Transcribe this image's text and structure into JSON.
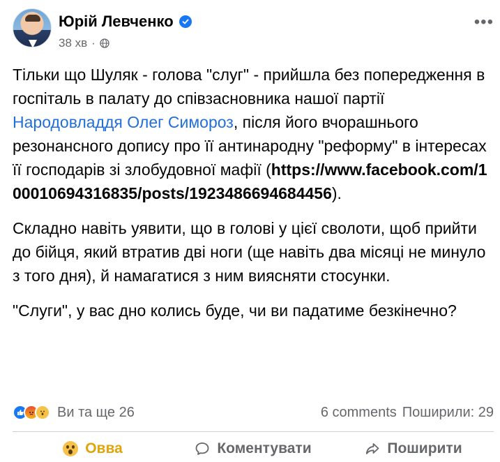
{
  "post": {
    "author": "Юрій Левченко",
    "time": "38 хв",
    "privacy_icon": "globe-icon",
    "more_label": "•••",
    "paragraphs": {
      "p1_a": "Тільки що Шуляк - голова \"слуг\" - прийшла без попередження в госпіталь в палату до співзасновника нашої партії ",
      "p1_link": "Народовладдя Олег Симороз",
      "p1_b": ", після його вчорашнього резонансного допису про її антинародну \"реформу\" в інтересах її господарів зі злобудовної мафії (",
      "p1_url": "https://www.facebook.com/100010694316835/posts/1923486694684456",
      "p1_c": ").",
      "p2": "Складно навіть уявити, що в голові у цієї сволоти, щоб прийти до бійця, який втратив дві ноги (ще навіть два місяці не минуло з того дня), й намагатися з ним виясняти стосунки.",
      "p3": "\"Слуги\", у вас дно колись буде, чи ви падатиме безкінечно?"
    }
  },
  "reactions": {
    "icons": [
      "like-icon",
      "angry-icon",
      "wow-icon"
    ],
    "summary": "Ви та ще 26",
    "comments": "6 comments",
    "shares": "Поширили: 29"
  },
  "actions": {
    "react": "Овва",
    "comment": "Коментувати",
    "share": "Поширити"
  },
  "colors": {
    "link": "#216fdb",
    "verified": "#1877f2",
    "wow_active": "#e0a50a",
    "muted": "#65676b"
  }
}
